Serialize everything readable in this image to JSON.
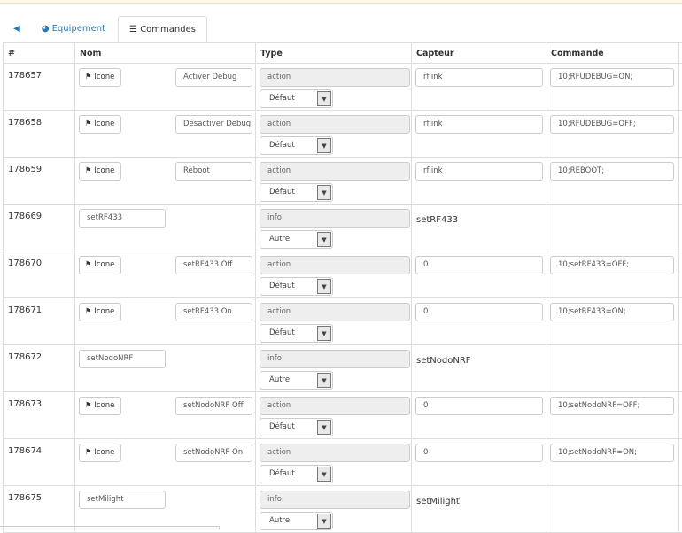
{
  "tabs": {
    "back_icon": "arrow-circle-left",
    "equipement": "Equipement",
    "commandes": "Commandes"
  },
  "headers": {
    "id": "#",
    "nom": "Nom",
    "type": "Type",
    "capteur": "Capteur",
    "commande": "Commande"
  },
  "icon_button": "Icone",
  "rows": [
    {
      "id": "178657",
      "icon": true,
      "name": "Activer Debug",
      "type": "action",
      "subtype": "Défaut",
      "capteur": "rflink",
      "commande": "10;RFUDEBUG=ON;"
    },
    {
      "id": "178658",
      "icon": true,
      "name": "Désactiver Debug",
      "type": "action",
      "subtype": "Défaut",
      "capteur": "rflink",
      "commande": "10;RFUDEBUG=OFF;"
    },
    {
      "id": "178659",
      "icon": true,
      "name": "Reboot",
      "type": "action",
      "subtype": "Défaut",
      "capteur": "rflink",
      "commande": "10;REBOOT;"
    },
    {
      "id": "178669",
      "icon": false,
      "name": "setRF433",
      "type": "info",
      "subtype": "Autre",
      "capteur": "setRF433",
      "commande": ""
    },
    {
      "id": "178670",
      "icon": true,
      "name": "setRF433 Off",
      "type": "action",
      "subtype": "Défaut",
      "capteur": "0",
      "commande": "10;setRF433=OFF;"
    },
    {
      "id": "178671",
      "icon": true,
      "name": "setRF433 On",
      "type": "action",
      "subtype": "Défaut",
      "capteur": "0",
      "commande": "10;setRF433=ON;"
    },
    {
      "id": "178672",
      "icon": false,
      "name": "setNodoNRF",
      "type": "info",
      "subtype": "Autre",
      "capteur": "setNodoNRF",
      "commande": ""
    },
    {
      "id": "178673",
      "icon": true,
      "name": "setNodoNRF Off",
      "type": "action",
      "subtype": "Défaut",
      "capteur": "0",
      "commande": "10;setNodoNRF=OFF;"
    },
    {
      "id": "178674",
      "icon": true,
      "name": "setNodoNRF On",
      "type": "action",
      "subtype": "Défaut",
      "capteur": "0",
      "commande": "10;setNodoNRF=ON;"
    },
    {
      "id": "178675",
      "icon": false,
      "name": "setMilight",
      "type": "info",
      "subtype": "Autre",
      "capteur": "setMilight",
      "commande": ""
    }
  ]
}
